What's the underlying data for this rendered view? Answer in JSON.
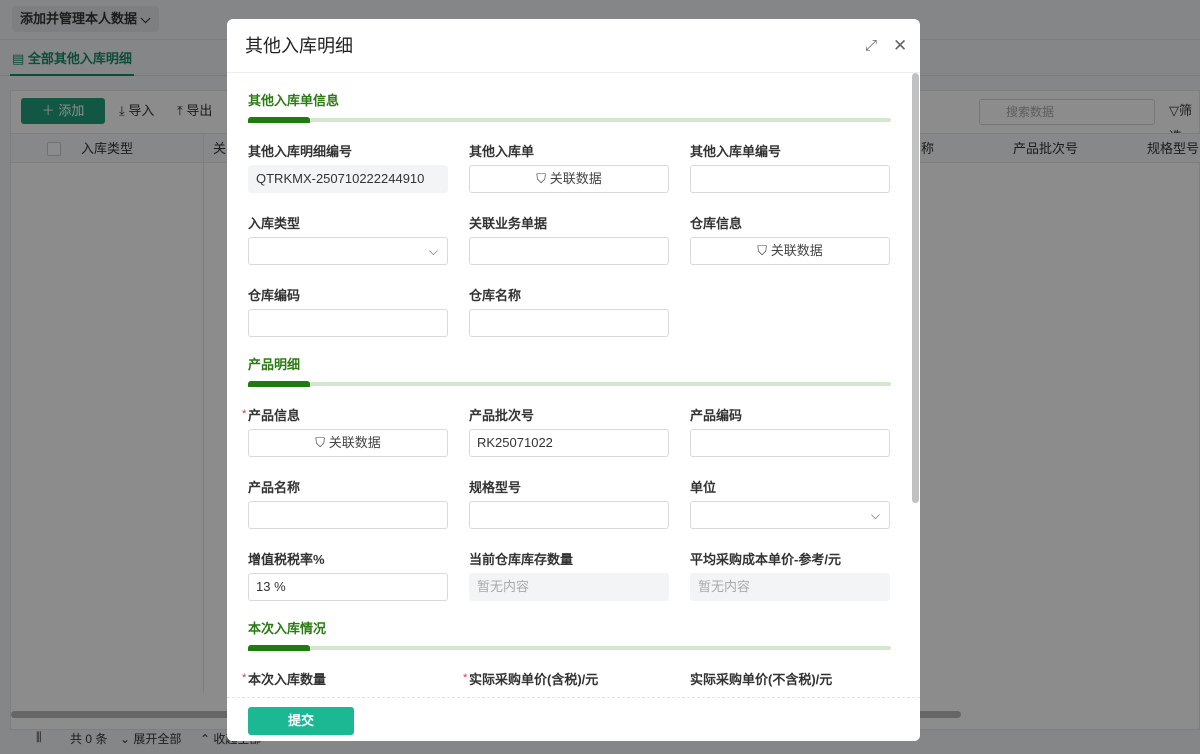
{
  "background": {
    "scope_selector": "添加并管理本人数据",
    "tab": "全部其他入库明细",
    "toolbar": {
      "add": "添加",
      "import": "导入",
      "export": "导出",
      "search_placeholder": "搜索数据",
      "filter": "筛选"
    },
    "columns": [
      "入库类型",
      "关",
      "称",
      "产品批次号",
      "规格型号"
    ],
    "footer": {
      "count": "共 0 条",
      "expand": "展开全部",
      "collapse": "收起全部"
    }
  },
  "modal": {
    "title": "其他入库明细",
    "sections": [
      {
        "title": "其他入库单信息",
        "fields": [
          {
            "label": "其他入库明细编号",
            "value": "QTRKMX-250710222244910",
            "kind": "readonly"
          },
          {
            "label": "其他入库单",
            "value": "关联数据",
            "kind": "link"
          },
          {
            "label": "其他入库单编号",
            "value": "",
            "kind": "text"
          },
          {
            "label": "入库类型",
            "value": "",
            "kind": "select"
          },
          {
            "label": "关联业务单据",
            "value": "",
            "kind": "text"
          },
          {
            "label": "仓库信息",
            "value": "关联数据",
            "kind": "link"
          },
          {
            "label": "仓库编码",
            "value": "",
            "kind": "text"
          },
          {
            "label": "仓库名称",
            "value": "",
            "kind": "text"
          }
        ]
      },
      {
        "title": "产品明细",
        "fields": [
          {
            "label": "产品信息",
            "value": "关联数据",
            "kind": "link",
            "required": true
          },
          {
            "label": "产品批次号",
            "value": "RK25071022",
            "kind": "text"
          },
          {
            "label": "产品编码",
            "value": "",
            "kind": "text"
          },
          {
            "label": "产品名称",
            "value": "",
            "kind": "text"
          },
          {
            "label": "规格型号",
            "value": "",
            "kind": "text"
          },
          {
            "label": "单位",
            "value": "",
            "kind": "select"
          },
          {
            "label": "增值税税率%",
            "value": "13 %",
            "kind": "text"
          },
          {
            "label": "当前仓库库存数量",
            "value": "暂无内容",
            "kind": "readonly-empty"
          },
          {
            "label": "平均采购成本单价-参考/元",
            "value": "暂无内容",
            "kind": "readonly-empty"
          }
        ]
      },
      {
        "title": "本次入库情况",
        "fields": [
          {
            "label": "本次入库数量",
            "required": true
          },
          {
            "label": "实际采购单价(含税)/元",
            "required": true
          },
          {
            "label": "实际采购单价(不含税)/元"
          }
        ]
      }
    ],
    "submit": "提交"
  }
}
